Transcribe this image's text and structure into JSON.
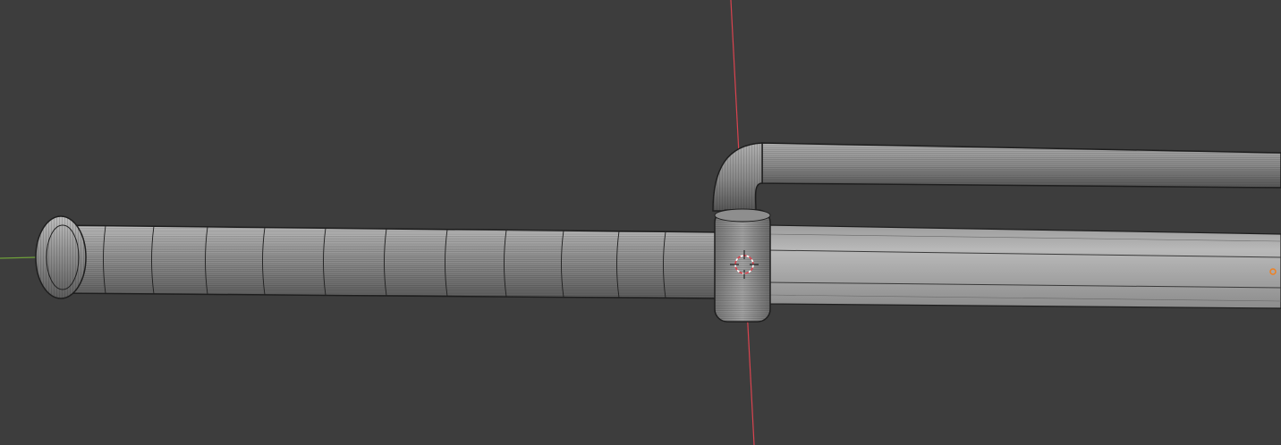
{
  "app": "3D viewport",
  "viewport": {
    "background": "#3d3d3d",
    "axis_x_color": "#d9434f",
    "axis_y_color": "#6fa13a",
    "mesh_fill": "#8f8f8f",
    "mesh_wire": "#1e1e1e",
    "blade_fill": "#a8a8a8",
    "origin_color": "#f08020"
  },
  "scene": {
    "objects": [
      {
        "name": "handle-grip",
        "type": "mesh"
      },
      {
        "name": "pommel",
        "type": "mesh"
      },
      {
        "name": "guard-ring",
        "type": "mesh"
      },
      {
        "name": "knuckle-bow",
        "type": "mesh"
      },
      {
        "name": "blade",
        "type": "mesh"
      }
    ],
    "gizmos": [
      "3d-cursor",
      "object-origin",
      "x-axis-line",
      "y-axis-line"
    ]
  }
}
